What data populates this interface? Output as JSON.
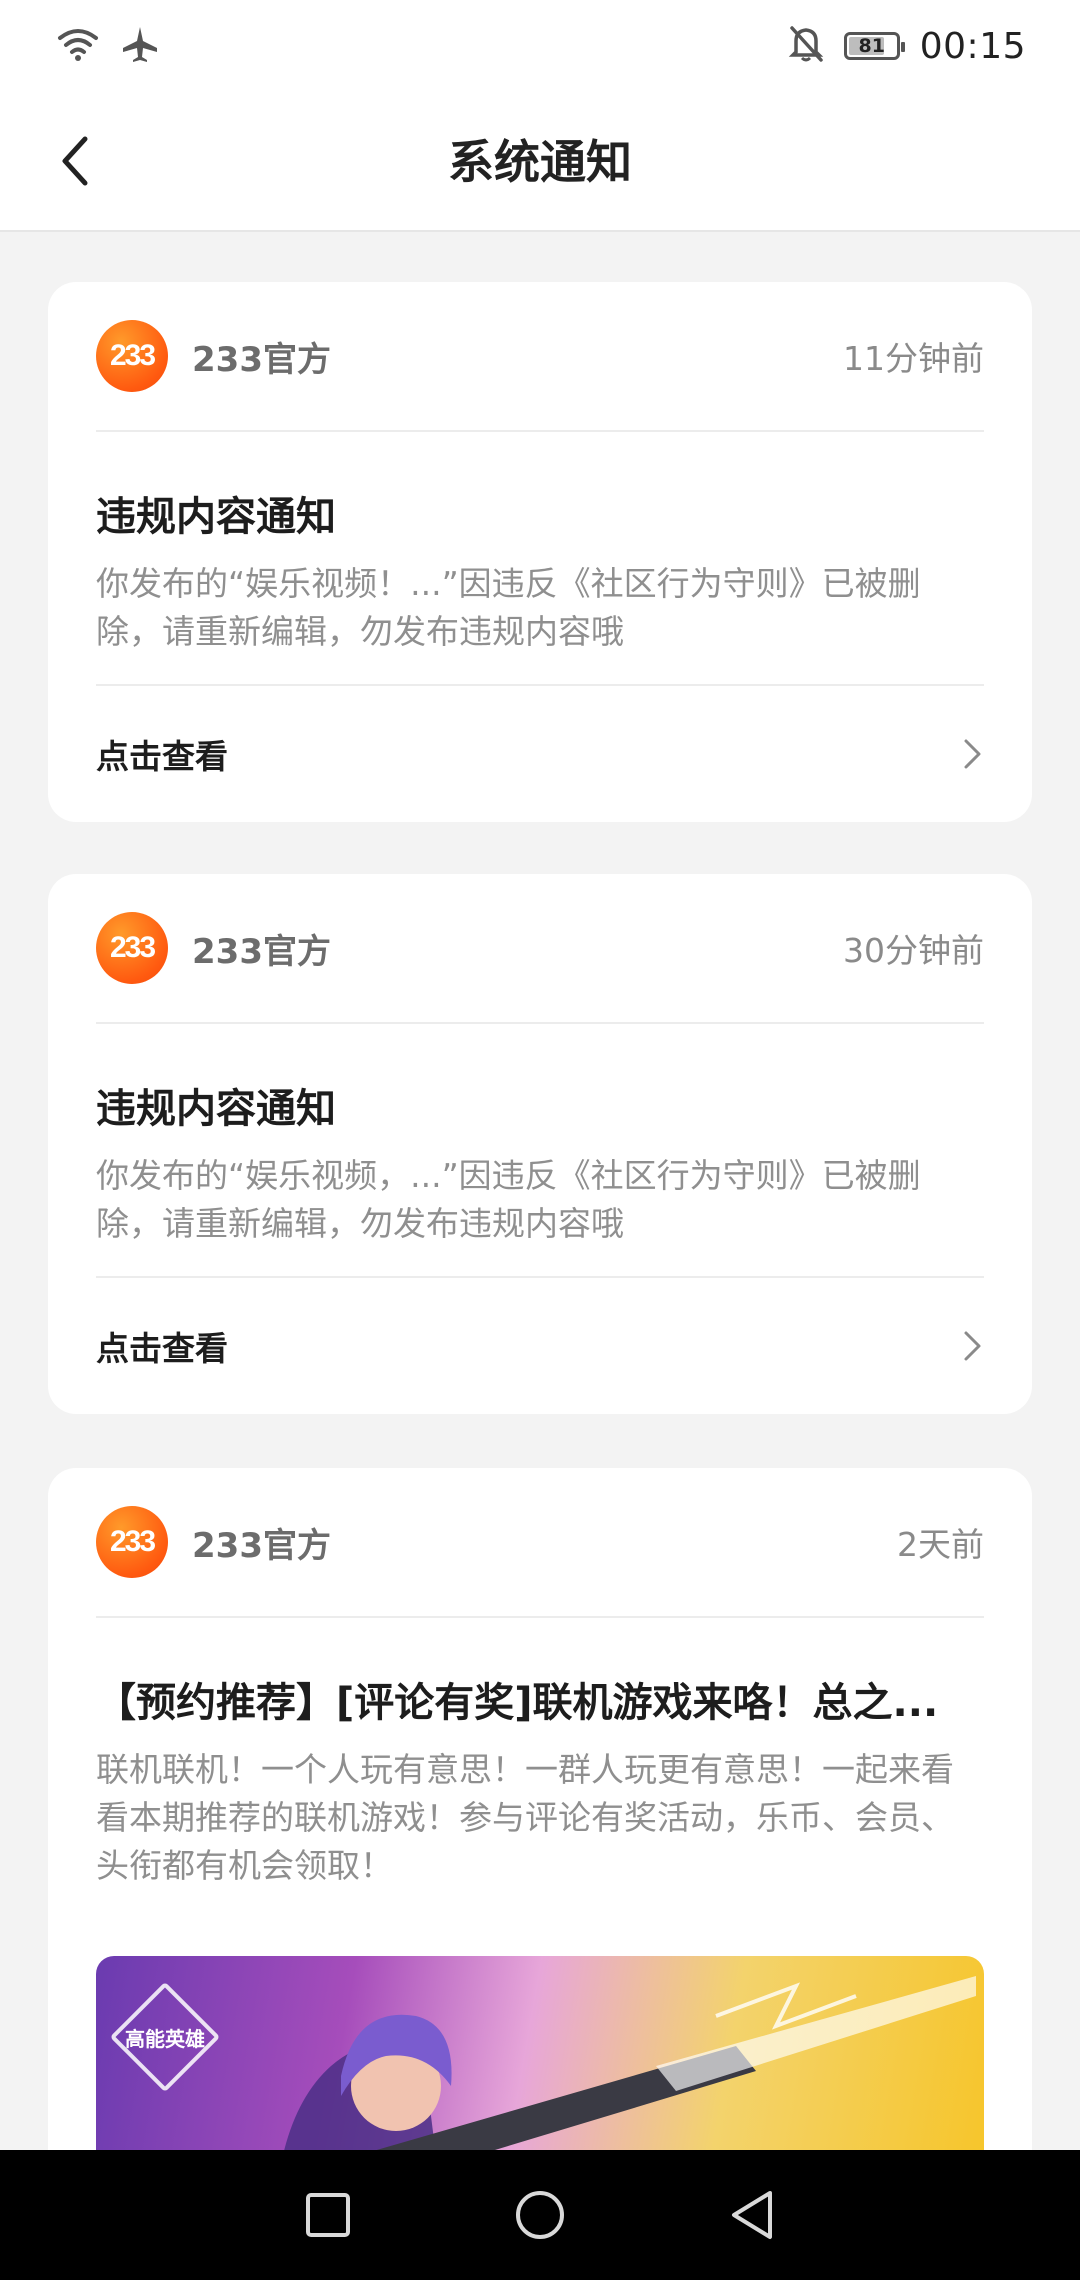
{
  "status_bar": {
    "battery": "81",
    "time": "00:15"
  },
  "app_bar": {
    "title": "系统通知"
  },
  "notifications": [
    {
      "avatar_text": "233",
      "sender": "233官方",
      "time": "11分钟前",
      "title": "违规内容通知",
      "body": "你发布的“娱乐视频！...”因违反《社区行为守则》已被删除，请重新编辑，勿发布违规内容哦",
      "action": "点击查看"
    },
    {
      "avatar_text": "233",
      "sender": "233官方",
      "time": "30分钟前",
      "title": "违规内容通知",
      "body": "你发布的“娱乐视频，...”因违反《社区行为守则》已被删除，请重新编辑，勿发布违规内容哦",
      "action": "点击查看"
    },
    {
      "avatar_text": "233",
      "sender": "233官方",
      "time": "2天前",
      "title": "【预约推荐】[评论有奖]联机游戏来咯！总之...",
      "body": "联机联机！一个人玩有意思！一群人玩更有意思！一起来看看本期推荐的联机游戏！参与评论有奖活动，乐币、会员、头衔都有机会领取！",
      "banner_logo": "高能英雄"
    }
  ],
  "colors": {
    "accent_orange": "#ff5a10",
    "background": "#f3f3f3"
  }
}
